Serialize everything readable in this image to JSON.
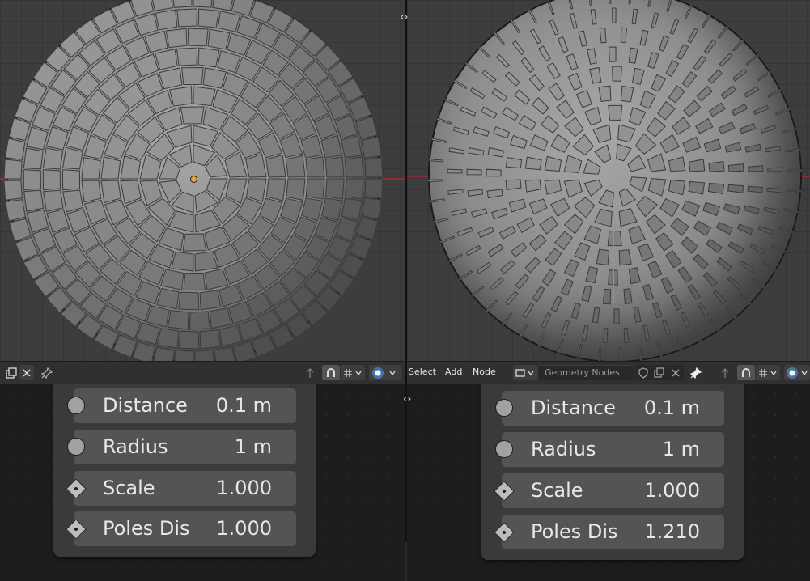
{
  "left_header": {
    "icons": [
      "node-tree-icon",
      "close-icon",
      "pin-icon",
      "parent-icon",
      "snap-icon",
      "snap-target-icon",
      "overlay-icon"
    ]
  },
  "right_header": {
    "menus": [
      "Select",
      "Add",
      "Node"
    ],
    "tree_name": "Geometry Nodes",
    "icons": [
      "editor-type-icon",
      "fake-user-shield-icon",
      "duplicate-icon",
      "close-icon",
      "pin-icon",
      "parent-icon",
      "snap-icon",
      "snap-target-icon",
      "overlay-icon"
    ]
  },
  "left_node": {
    "fields": [
      {
        "label": "Distance",
        "value": "0.1 m",
        "socket": "circle"
      },
      {
        "label": "Radius",
        "value": "1 m",
        "socket": "circle"
      },
      {
        "label": "Scale",
        "value": "1.000",
        "socket": "diamond"
      },
      {
        "label": "Poles Dis",
        "value": "1.000",
        "socket": "diamond"
      }
    ]
  },
  "right_node": {
    "fields": [
      {
        "label": "Distance",
        "value": "0.1 m",
        "socket": "circle"
      },
      {
        "label": "Radius",
        "value": "1 m",
        "socket": "circle"
      },
      {
        "label": "Scale",
        "value": "1.000",
        "socket": "diamond"
      },
      {
        "label": "Poles Dis",
        "value": "1.210",
        "socket": "diamond"
      }
    ]
  },
  "split_arrows": "‹›",
  "colors": {
    "accent": "#4772b3",
    "x_axis": "#8a2e3c",
    "origin": "#f0a030"
  }
}
